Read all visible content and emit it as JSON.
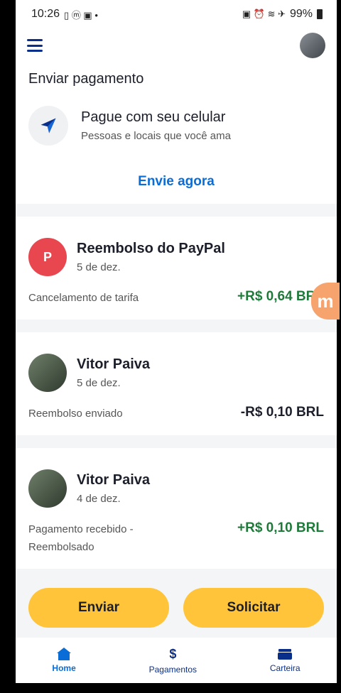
{
  "status": {
    "time": "10:26",
    "battery": "99%"
  },
  "send": {
    "title": "Enviar pagamento",
    "heading": "Pague com seu celular",
    "subtitle": "Pessoas e locais que você ama",
    "link": "Envie agora"
  },
  "transactions": [
    {
      "initial": "P",
      "name": "Reembolso do PayPal",
      "date": "5 de dez.",
      "desc": "Cancelamento de tarifa",
      "amount": "+R$ 0,64 BRL",
      "color": "#e8474f"
    },
    {
      "name": "Vitor Paiva",
      "date": "5 de dez.",
      "desc": "Reembolso enviado",
      "amount": "-R$ 0,10 BRL"
    },
    {
      "name": "Vitor Paiva",
      "date": "4 de dez.",
      "desc": "Pagamento recebido - Reembolsado",
      "amount": "+R$ 0,10 BRL"
    }
  ],
  "actions": {
    "send": "Enviar",
    "request": "Solicitar"
  },
  "nav": {
    "home": "Home",
    "payments": "Pagamentos",
    "wallet": "Carteira"
  },
  "colors": {
    "accent": "#0a6cd6",
    "button": "#ffc439",
    "positive": "#1f7a3a"
  }
}
